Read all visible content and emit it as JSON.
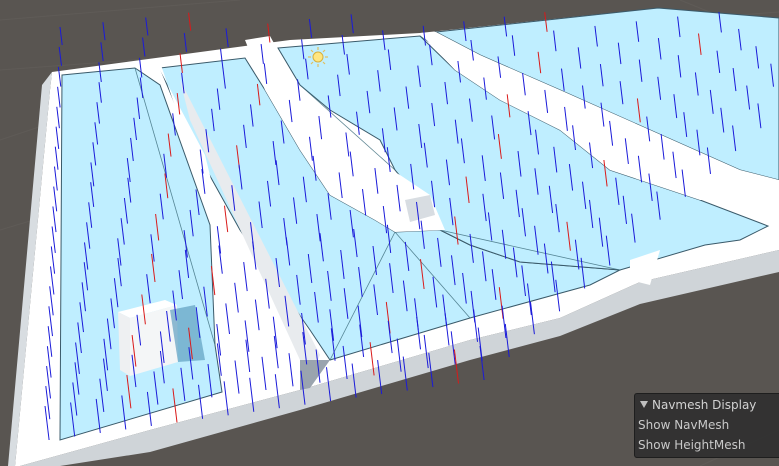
{
  "navmesh_panel": {
    "title": "Navmesh Display",
    "show_navmesh_label": "Show NavMesh",
    "show_heightmesh_label": "Show HeightMesh"
  },
  "scene": {
    "background_color": "#595551",
    "navmesh_color": "#bfeeff",
    "navmesh_edge_color": "#3a5a6a",
    "ground_color": "#ffffff",
    "wall_shade_color": "#d4d9de",
    "height_mark_blue": "#1a1ad9",
    "height_mark_red": "#d91a1a",
    "icons": [
      "sun-icon",
      "foldout-triangle-icon"
    ]
  }
}
